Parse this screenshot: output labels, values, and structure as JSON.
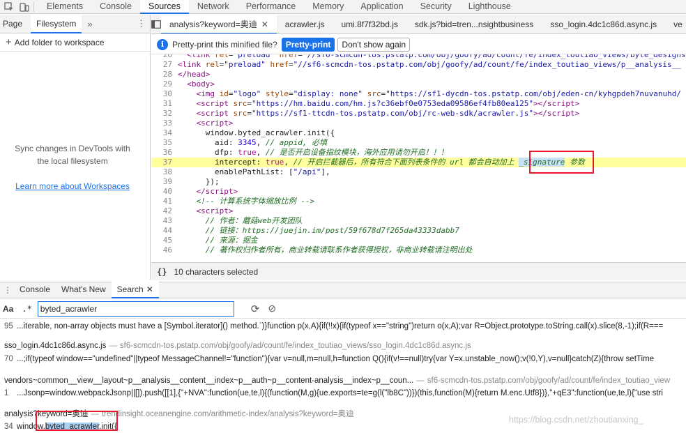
{
  "top_tabs": [
    "Elements",
    "Console",
    "Sources",
    "Network",
    "Performance",
    "Memory",
    "Application",
    "Security",
    "Lighthouse"
  ],
  "active_top_tab": "Sources",
  "navigator": {
    "tabs": [
      "Page",
      "Filesystem"
    ],
    "active": "Filesystem",
    "more": "»",
    "add_folder": "Add folder to workspace",
    "sync_line1": "Sync changes in DevTools with",
    "sync_line2": "the local filesystem",
    "learn_more": "Learn more about Workspaces"
  },
  "editor_tabs": [
    {
      "label": "analysis?keyword=奥迪",
      "active": true,
      "closable": true
    },
    {
      "label": "acrawler.js"
    },
    {
      "label": "umi.8f7f32bd.js"
    },
    {
      "label": "sdk.js?bid=tren...nsightbusiness"
    },
    {
      "label": "sso_login.4dc1c86d.async.js"
    },
    {
      "label": "ve"
    }
  ],
  "pretty_print": {
    "message": "Pretty-print this minified file?",
    "primary": "Pretty-print",
    "secondary": "Don't show again"
  },
  "code_lines": [
    {
      "n": "26",
      "html": "  <span class=\"tag\">&lt;link</span> <span class=\"attr\">rel</span>=<span class=\"val\">\"preload\"</span> <span class=\"attr\">href</span>=<span class=\"val\">\"//sf6-scmcdn-tos.pstatp.com/obj/goofy/ad/count/fe/index_toutiao_views/byte_designs...\"</span>"
    },
    {
      "n": "27",
      "html": "<span class=\"tag\">&lt;link</span> <span class=\"attr\">rel</span>=<span class=\"val\">\"preload\"</span> <span class=\"attr\">href</span>=<span class=\"val\">\"//sf6-scmcdn-tos.pstatp.com/obj/goofy/ad/count/fe/index_toutiao_views/p__analysis__</span>"
    },
    {
      "n": "28",
      "html": "<span class=\"tag\">&lt;/head&gt;</span>"
    },
    {
      "n": "29",
      "html": "  <span class=\"tag\">&lt;body&gt;</span>"
    },
    {
      "n": "30",
      "html": "    <span class=\"tag\">&lt;img</span> <span class=\"attr\">id</span>=<span class=\"val\">\"logo\"</span> <span class=\"attr\">style</span>=<span class=\"val\">\"display: none\"</span> <span class=\"attr\">src</span>=<span class=\"val\">\"https://sf1-dycdn-tos.pstatp.com/obj/eden-cn/kyhgpdeh7nuvanuhd/</span>"
    },
    {
      "n": "31",
      "html": "    <span class=\"tag\">&lt;script</span> <span class=\"attr\">src</span>=<span class=\"val\">\"https://hm.baidu.com/hm.js?c36ebf0e0753eda09586ef4fb80ea125\"</span><span class=\"tag\">&gt;&lt;/script&gt;</span>"
    },
    {
      "n": "32",
      "html": "    <span class=\"tag\">&lt;script</span> <span class=\"attr\">src</span>=<span class=\"val\">\"https://sf1-ttcdn-tos.pstatp.com/obj/rc-web-sdk/acrawler.js\"</span><span class=\"tag\">&gt;&lt;/script&gt;</span>"
    },
    {
      "n": "33",
      "html": "    <span class=\"tag\">&lt;script&gt;</span>"
    },
    {
      "n": "34",
      "html": "      window.byted_acrawler.init({"
    },
    {
      "n": "35",
      "html": "        aid: <span class=\"num\">3345</span>, <span class=\"cmt\">// appid, 必填</span>"
    },
    {
      "n": "36",
      "html": "        dfp: <span class=\"kw\">true</span>, <span class=\"cmt\">// 是否开启设备指纹模块，海外应用请勿开启！！！</span>"
    },
    {
      "n": "37",
      "html": "        intercept: <span class=\"kw\">true</span>, <span class=\"cmt\">// 开启拦截器后，所有符合下面列表条件的 url 都会自动加上 <span class=\"sel\">_signature</span> 参数</span>",
      "hl": true
    },
    {
      "n": "38",
      "html": "        enablePathList: [<span class=\"val\">\"/api\"</span>],"
    },
    {
      "n": "39",
      "html": "      });"
    },
    {
      "n": "40",
      "html": "    <span class=\"tag\">&lt;/script&gt;</span>"
    },
    {
      "n": "41",
      "html": "    <span class=\"cmt\">&lt;!-- 计算系统字体缩放比例 --&gt;</span>"
    },
    {
      "n": "42",
      "html": "    <span class=\"tag\">&lt;script&gt;</span>"
    },
    {
      "n": "43",
      "html": "      <span class=\"cmt\">// 作者：蘑菇web开发团队</span>"
    },
    {
      "n": "44",
      "html": "      <span class=\"cmt\">// 链接：https://juejin.im/post/59f678d7f265da43333dabb7</span>"
    },
    {
      "n": "45",
      "html": "      <span class=\"cmt\">// 来源：掘金</span>"
    },
    {
      "n": "46",
      "html": "      <span class=\"cmt\">// 著作权归作者所有，商业转载请联系作者获得授权，非商业转载请注明出处</span>"
    }
  ],
  "status_text": "10 characters selected",
  "braces": "{}",
  "drawer": {
    "tabs": [
      "Console",
      "What's New",
      "Search"
    ],
    "active": "Search"
  },
  "search": {
    "case_label": "Aa",
    "regex_label": ".*",
    "query": "byted_acrawler"
  },
  "results": [
    {
      "type": "line",
      "n": "95",
      "html": "...iterable, non-array objects must have a [Symbol.iterator]() method.`)}function p(x,A){if(!!x){if(typeof x==\"string\")return o(x,A);var R=Object.prototype.toString.call(x).slice(8,-1);if(R==="
    },
    {
      "type": "file",
      "file": "sso_login.4dc1c86d.async.js",
      "path": "sf6-scmcdn-tos.pstatp.com/obj/goofy/ad/count/fe/index_toutiao_views/sso_login.4dc1c86d.async.js"
    },
    {
      "type": "line",
      "n": "70",
      "html": "...;if(typeof window==\"undefined\"||typeof MessageChannel!=\"function\"){var v=null,m=null,h=function Q(){if(v!==null)try{var Y=x.unstable_now();v(!0,Y),v=null}catch(Z){throw setTime"
    },
    {
      "type": "file",
      "file": "vendors~common__view__layout~p__analysis__content__index~p__auth~p__content-analysis__index~p__coun...",
      "path": "sf6-scmcdn-tos.pstatp.com/obj/goofy/ad/count/fe/index_toutiao_view"
    },
    {
      "type": "line",
      "n": "1",
      "html": "...Jsonp=window.webpackJsonp||[]).push([[1],{\"+NVA\":function(ue,te,l){(function(M,g){ue.exports=te=g(l(\"lb8C\"))})(this,function(M){return M.enc.Utf8})},\"+qE3\":function(ue,te,l){\"use stri"
    },
    {
      "type": "file",
      "file": "analysis?keyword=奥迪",
      "path": "trendinsight.oceanengine.com/arithmetic-index/analysis?keyword=奥迪"
    },
    {
      "type": "line",
      "n": "34",
      "html": "window.<span class=\"match\">byted_acrawler</span>.init({"
    }
  ],
  "watermark": "https://blog.csdn.net/zhoutianxing_"
}
